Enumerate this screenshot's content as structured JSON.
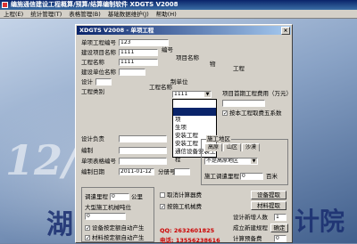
{
  "app": {
    "title": "编施通信建设工程概算/预算/结算编制软件  XDGTS V2008",
    "menu": [
      "上程(E)",
      "统计管理(T)",
      "表格管理(B)",
      "基础数据维护(J)",
      "帮助(H)"
    ],
    "background_text": [
      "12/",
      "湖",
      "计院"
    ]
  },
  "dialog": {
    "title": "XDGTS V2008 - 单项工程",
    "close_glyph": "×",
    "fields": {
      "dan_xiang_bian_hao": {
        "label": "单项工程编号",
        "value": "123"
      },
      "jian_she_xiang_mu_ming_cheng": {
        "label": "建设项目名称",
        "value": "1111"
      },
      "gong_cheng_ming_cheng": {
        "label": "工程名称",
        "value": "1111"
      },
      "jian_she_dan_wei": {
        "label": "建设单位名称",
        "value": ""
      },
      "she_ji": {
        "label": "设计",
        "value": ""
      },
      "gong_cheng_lei_bie": {
        "label": "工程类别",
        "value": "1111"
      },
      "she_ji_fu_ze_ren": {
        "label": "设计负责",
        "value": ""
      },
      "bian_zhi": {
        "label": "编制",
        "value": ""
      },
      "dan_xiang_biao_ge_bian_hao": {
        "label": "单项表格编号",
        "value": ""
      },
      "bian_zhi_ri_qi": {
        "label": "编制日期",
        "value": "2011-01-12"
      },
      "fen_ce_shu": {
        "label": "分册号",
        "value": ""
      }
    },
    "overlay_labels": [
      "编号",
      "项目名称",
      "物",
      "工程",
      "制单位",
      "工程名称"
    ],
    "right_labels": {
      "xiang_mu_zong_fei_yong": "项目首期工程费用（万元）",
      "wan_yuan_unit": "",
      "ban_ben": "按本工程取费五系数"
    },
    "dropdown": {
      "items": [
        "",
        "",
        "项",
        "生项",
        "安装工程",
        "安装工程",
        "通信设备安装工程"
      ],
      "selected_index": 1
    },
    "construction_area": {
      "title": "施工地区",
      "tabs": [
        "高原",
        "山区",
        "沙漠"
      ],
      "select_value": "不是高原地区",
      "distance_label": "施工调遣里程",
      "distance_value": "0",
      "distance_unit": "百米"
    },
    "lower": {
      "tiao_qian_li_cheng_label": "调遣里程",
      "tiao_qian_li_cheng_value": "0",
      "gong_li_unit": "公里",
      "da_xing_ji_xie_label": "大型施工机械吨位",
      "da_xing_ji_xie_value": "0",
      "she_bei_label": "设备按定额自动产生",
      "cai_liao_label": "材料按定额自动产生",
      "qu_xiao_ji_suan_label": "取消计算器费",
      "an_ding_e_label": "按施工机械费",
      "set_default_button": "设备提取",
      "material_button": "材料提取",
      "design_new_label": "设计新增人数",
      "design_new_value": "1",
      "ok_button": "确定",
      "engineer_note": "成立新建规程",
      "budget_label": "计算预备费",
      "budget_value": "0",
      "qq": "QQ: 2632601825",
      "phone": "电话: 13556238616"
    }
  },
  "colors": {
    "titlebar": "#0a246a",
    "dialog_face": "#d4d0c8",
    "accent_red": "#cc0000"
  }
}
